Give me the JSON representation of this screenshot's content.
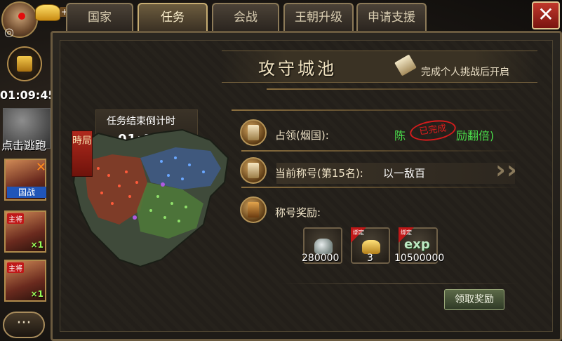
{
  "tabs": [
    {
      "label": "国家",
      "active": false
    },
    {
      "label": "任务",
      "active": true
    },
    {
      "label": "会战",
      "active": false
    },
    {
      "label": "王朝升级",
      "active": false
    },
    {
      "label": "申请支援",
      "active": false
    }
  ],
  "close_label": "✕",
  "hud": {
    "timer": "01:09:45",
    "escape_label": "点击逃跑",
    "war_label": "国战",
    "hero_tag": "主将",
    "hero_count": "×1",
    "chat_label": "···"
  },
  "panel": {
    "title": "攻守城池",
    "unlock_note": "完成个人挑战后开启",
    "countdown_label": "任务结束倒计时",
    "countdown_value": "01:09:45",
    "map_seal": "時局",
    "occupy_label": "占领(烟国):",
    "occupy_value": "陈",
    "occupy_value_tail": "励翻倍)",
    "stamp_text": "已完成",
    "rank_label": "当前称号(第15名):",
    "rank_value": "以一敌百",
    "reward_label": "称号奖励:",
    "claim_button": "领取奖励"
  },
  "rewards": [
    {
      "icon": "silver-icon",
      "amount": "280000",
      "badge": ""
    },
    {
      "icon": "gold-ingot-icon",
      "amount": "3",
      "badge": "绑定"
    },
    {
      "icon": "exp-icon",
      "amount": "10500000",
      "badge": "绑定",
      "icon_text": "exp"
    }
  ],
  "colors": {
    "occupy_text": "#4adb4a",
    "stamp": "#d31c1c",
    "close_button": "#c0392b"
  }
}
